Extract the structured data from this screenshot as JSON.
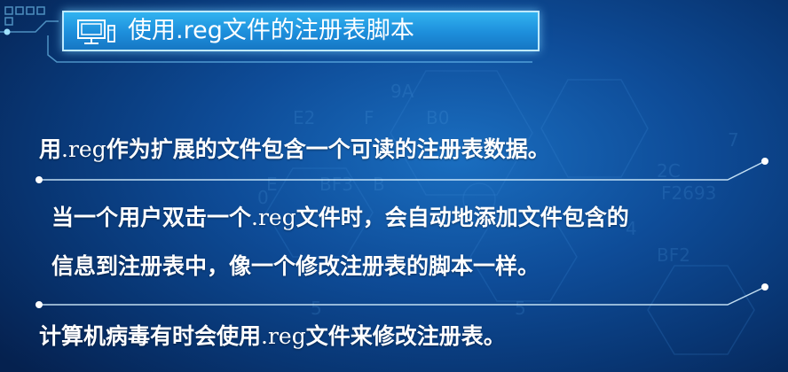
{
  "title": "使用.reg文件的注册表脚本",
  "icons": {
    "title": "computer-monitor-icon"
  },
  "colors": {
    "title_bar": "#1d8edb",
    "background": "#0e4c98",
    "accent_line": "#bfeaff"
  },
  "lines": [
    {
      "before": "用",
      "reg": ".reg",
      "after": "作为扩展的文件包含一个可读的注册表数据。"
    },
    {
      "before": "当一个用户双击一个",
      "reg": ".reg",
      "after": "文件时，会自动地添加文件包含的"
    },
    {
      "before": "信息到注册表中，像一个修改注册表的脚本一样。",
      "reg": "",
      "after": ""
    },
    {
      "before": "计算机病毒有时会使用",
      "reg": ".reg",
      "after": "文件来修改注册表。"
    }
  ]
}
